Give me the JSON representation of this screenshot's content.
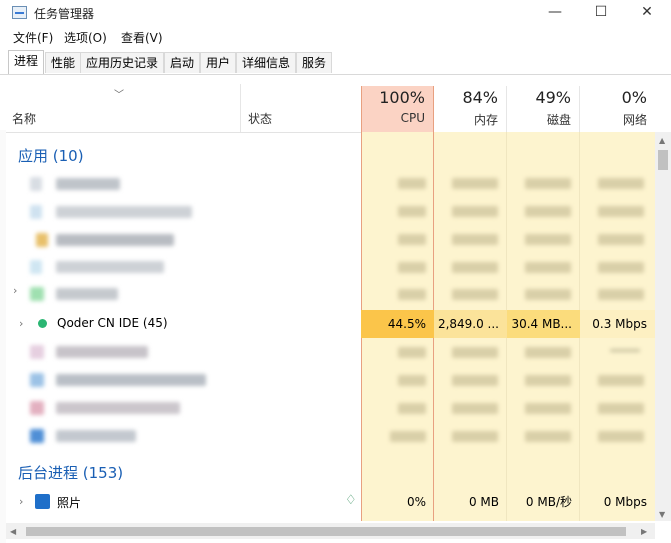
{
  "window": {
    "title": "任务管理器",
    "minimize": "—",
    "maximize": "☐",
    "close": "✕"
  },
  "menu": [
    "文件(F)",
    "选项(O)",
    "查看(V)"
  ],
  "tabs": [
    "进程",
    "性能",
    "应用历史记录",
    "启动",
    "用户",
    "详细信息",
    "服务"
  ],
  "active_tab": "进程",
  "columns": {
    "name": "名称",
    "status": "状态",
    "cpu": {
      "pct": "100%",
      "label": "CPU"
    },
    "memory": {
      "pct": "84%",
      "label": "内存"
    },
    "disk": {
      "pct": "49%",
      "label": "磁盘"
    },
    "network": {
      "pct": "0%",
      "label": "网络"
    }
  },
  "groups": {
    "apps": "应用 (10)",
    "background": "后台进程 (153)"
  },
  "highlight_row": {
    "name": "Qoder CN IDE (45)",
    "cpu": "44.5%",
    "memory": "2,849.0 ...",
    "disk": "30.4 MB...",
    "network": "0.3 Mbps"
  },
  "background_row": {
    "name": "照片",
    "cpu": "0%",
    "memory": "0 MB",
    "disk": "0 MB/秒",
    "network": "0 Mbps"
  },
  "colors": {
    "cpu_header": "#fbd3c4",
    "cell_light": "#fdf4cf",
    "cell_mid": "#fbe9a8",
    "cell_hot": "#fbc54a",
    "group_text": "#1a5fb4"
  }
}
